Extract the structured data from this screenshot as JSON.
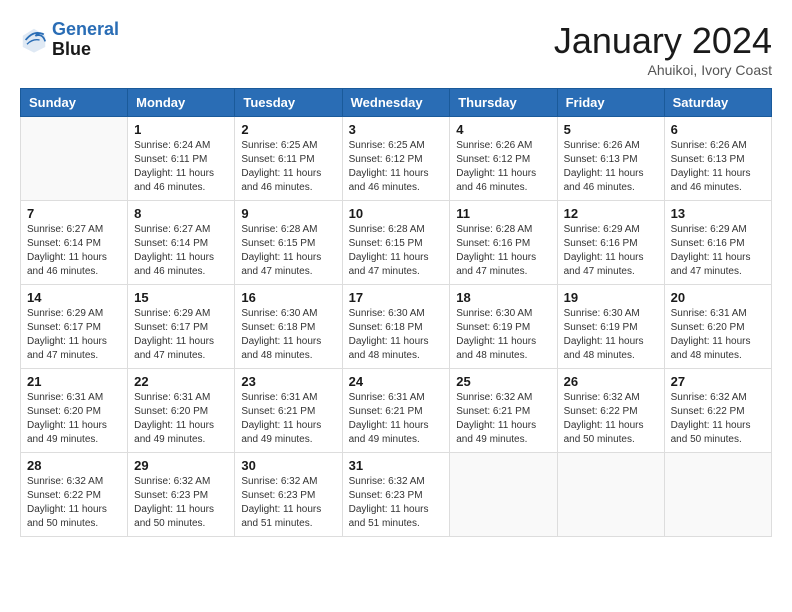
{
  "header": {
    "logo_line1": "General",
    "logo_line2": "Blue",
    "month_title": "January 2024",
    "location": "Ahuikoi, Ivory Coast"
  },
  "weekdays": [
    "Sunday",
    "Monday",
    "Tuesday",
    "Wednesday",
    "Thursday",
    "Friday",
    "Saturday"
  ],
  "weeks": [
    [
      {
        "day": "",
        "info": ""
      },
      {
        "day": "1",
        "info": "Sunrise: 6:24 AM\nSunset: 6:11 PM\nDaylight: 11 hours\nand 46 minutes."
      },
      {
        "day": "2",
        "info": "Sunrise: 6:25 AM\nSunset: 6:11 PM\nDaylight: 11 hours\nand 46 minutes."
      },
      {
        "day": "3",
        "info": "Sunrise: 6:25 AM\nSunset: 6:12 PM\nDaylight: 11 hours\nand 46 minutes."
      },
      {
        "day": "4",
        "info": "Sunrise: 6:26 AM\nSunset: 6:12 PM\nDaylight: 11 hours\nand 46 minutes."
      },
      {
        "day": "5",
        "info": "Sunrise: 6:26 AM\nSunset: 6:13 PM\nDaylight: 11 hours\nand 46 minutes."
      },
      {
        "day": "6",
        "info": "Sunrise: 6:26 AM\nSunset: 6:13 PM\nDaylight: 11 hours\nand 46 minutes."
      }
    ],
    [
      {
        "day": "7",
        "info": "Sunrise: 6:27 AM\nSunset: 6:14 PM\nDaylight: 11 hours\nand 46 minutes."
      },
      {
        "day": "8",
        "info": "Sunrise: 6:27 AM\nSunset: 6:14 PM\nDaylight: 11 hours\nand 46 minutes."
      },
      {
        "day": "9",
        "info": "Sunrise: 6:28 AM\nSunset: 6:15 PM\nDaylight: 11 hours\nand 47 minutes."
      },
      {
        "day": "10",
        "info": "Sunrise: 6:28 AM\nSunset: 6:15 PM\nDaylight: 11 hours\nand 47 minutes."
      },
      {
        "day": "11",
        "info": "Sunrise: 6:28 AM\nSunset: 6:16 PM\nDaylight: 11 hours\nand 47 minutes."
      },
      {
        "day": "12",
        "info": "Sunrise: 6:29 AM\nSunset: 6:16 PM\nDaylight: 11 hours\nand 47 minutes."
      },
      {
        "day": "13",
        "info": "Sunrise: 6:29 AM\nSunset: 6:16 PM\nDaylight: 11 hours\nand 47 minutes."
      }
    ],
    [
      {
        "day": "14",
        "info": "Sunrise: 6:29 AM\nSunset: 6:17 PM\nDaylight: 11 hours\nand 47 minutes."
      },
      {
        "day": "15",
        "info": "Sunrise: 6:29 AM\nSunset: 6:17 PM\nDaylight: 11 hours\nand 47 minutes."
      },
      {
        "day": "16",
        "info": "Sunrise: 6:30 AM\nSunset: 6:18 PM\nDaylight: 11 hours\nand 48 minutes."
      },
      {
        "day": "17",
        "info": "Sunrise: 6:30 AM\nSunset: 6:18 PM\nDaylight: 11 hours\nand 48 minutes."
      },
      {
        "day": "18",
        "info": "Sunrise: 6:30 AM\nSunset: 6:19 PM\nDaylight: 11 hours\nand 48 minutes."
      },
      {
        "day": "19",
        "info": "Sunrise: 6:30 AM\nSunset: 6:19 PM\nDaylight: 11 hours\nand 48 minutes."
      },
      {
        "day": "20",
        "info": "Sunrise: 6:31 AM\nSunset: 6:20 PM\nDaylight: 11 hours\nand 48 minutes."
      }
    ],
    [
      {
        "day": "21",
        "info": "Sunrise: 6:31 AM\nSunset: 6:20 PM\nDaylight: 11 hours\nand 49 minutes."
      },
      {
        "day": "22",
        "info": "Sunrise: 6:31 AM\nSunset: 6:20 PM\nDaylight: 11 hours\nand 49 minutes."
      },
      {
        "day": "23",
        "info": "Sunrise: 6:31 AM\nSunset: 6:21 PM\nDaylight: 11 hours\nand 49 minutes."
      },
      {
        "day": "24",
        "info": "Sunrise: 6:31 AM\nSunset: 6:21 PM\nDaylight: 11 hours\nand 49 minutes."
      },
      {
        "day": "25",
        "info": "Sunrise: 6:32 AM\nSunset: 6:21 PM\nDaylight: 11 hours\nand 49 minutes."
      },
      {
        "day": "26",
        "info": "Sunrise: 6:32 AM\nSunset: 6:22 PM\nDaylight: 11 hours\nand 50 minutes."
      },
      {
        "day": "27",
        "info": "Sunrise: 6:32 AM\nSunset: 6:22 PM\nDaylight: 11 hours\nand 50 minutes."
      }
    ],
    [
      {
        "day": "28",
        "info": "Sunrise: 6:32 AM\nSunset: 6:22 PM\nDaylight: 11 hours\nand 50 minutes."
      },
      {
        "day": "29",
        "info": "Sunrise: 6:32 AM\nSunset: 6:23 PM\nDaylight: 11 hours\nand 50 minutes."
      },
      {
        "day": "30",
        "info": "Sunrise: 6:32 AM\nSunset: 6:23 PM\nDaylight: 11 hours\nand 51 minutes."
      },
      {
        "day": "31",
        "info": "Sunrise: 6:32 AM\nSunset: 6:23 PM\nDaylight: 11 hours\nand 51 minutes."
      },
      {
        "day": "",
        "info": ""
      },
      {
        "day": "",
        "info": ""
      },
      {
        "day": "",
        "info": ""
      }
    ]
  ]
}
